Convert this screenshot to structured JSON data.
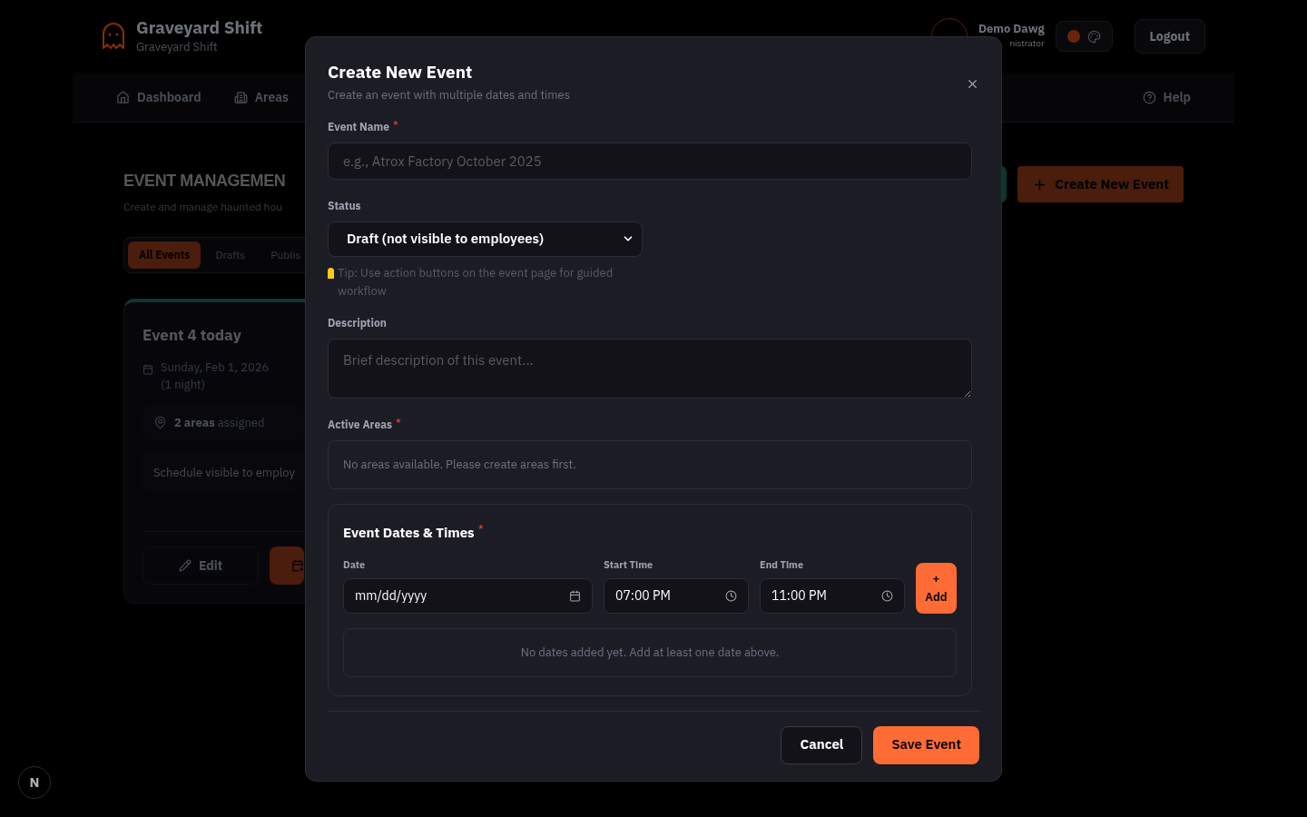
{
  "header": {
    "title": "Graveyard Shift",
    "subtitle": "Graveyard Shift",
    "user_name": "Demo Dawg",
    "user_role": "nistrator",
    "logout": "Logout"
  },
  "nav": {
    "items": [
      {
        "label": "Dashboard",
        "kind": "home"
      },
      {
        "label": "Areas",
        "kind": "building"
      }
    ],
    "help": "Help"
  },
  "page": {
    "title": "EVENT MANAGEMEN",
    "subtitle": "Create and manage haunted hou",
    "create_button": "Create New Event",
    "filters": [
      {
        "label": "All Events",
        "selected": true
      },
      {
        "label": "Drafts",
        "selected": false
      },
      {
        "label": "Publis",
        "selected": false
      }
    ],
    "card": {
      "title": "Event 4 today",
      "date": "Sunday, Feb 1, 2026",
      "nights": "(1 night)",
      "areas": "**2 areas** assigned",
      "schedule": "Schedule visible to employ",
      "edit": "Edit"
    }
  },
  "dialog": {
    "title": "Create New Event",
    "subtitle": "Create an event with multiple dates and times",
    "event_name": {
      "label": "Event Name",
      "required": true,
      "placeholder": "e.g., Atrox Factory October 2025"
    },
    "status": {
      "label": "Status",
      "value": "Draft (not visible to employees)",
      "tip": "Tip: Use action buttons on the event page for guided workflow"
    },
    "description": {
      "label": "Description",
      "placeholder": "Brief description of this event..."
    },
    "active_areas": {
      "label": "Active Areas",
      "required": true,
      "empty": "No areas available. Please create areas first."
    },
    "dates": {
      "title": "Event Dates & Times",
      "required": true,
      "fields": [
        {
          "label": "Date",
          "value": "mm/dd/yyyy",
          "kind": "date"
        },
        {
          "label": "Start Time",
          "value": "07:00 PM",
          "kind": "time"
        },
        {
          "label": "End Time",
          "value": "11:00 PM",
          "kind": "time"
        }
      ],
      "add_icon": "+",
      "add": "Add",
      "empty": "No dates added yet. Add at least one date above."
    },
    "required_mark": "*",
    "cancel": "Cancel",
    "save": "Save Event"
  },
  "dev_badge": "N"
}
